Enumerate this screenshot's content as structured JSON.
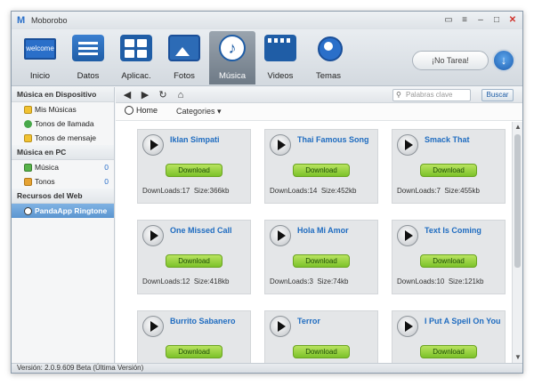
{
  "window": {
    "title": "Moborobo",
    "logo": "M"
  },
  "toolbar": {
    "items": [
      {
        "label": "Inicio",
        "icon": "welcome-icon",
        "badge": "welcome"
      },
      {
        "label": "Datos",
        "icon": "contacts-icon"
      },
      {
        "label": "Aplicac.",
        "icon": "apps-icon"
      },
      {
        "label": "Fotos",
        "icon": "photos-icon"
      },
      {
        "label": "Música",
        "icon": "music-icon"
      },
      {
        "label": "Videos",
        "icon": "videos-icon"
      },
      {
        "label": "Temas",
        "icon": "themes-icon"
      }
    ],
    "active": "Música",
    "task_status": "¡No Tarea!"
  },
  "sidebar": {
    "sections": [
      {
        "header": "Música en Dispositivo",
        "items": [
          {
            "label": "Mis Músicas",
            "icon": "note-icon"
          },
          {
            "label": "Tonos de llamada",
            "icon": "phone-icon"
          },
          {
            "label": "Tonos de mensaje",
            "icon": "message-icon"
          }
        ]
      },
      {
        "header": "Música en PC",
        "items": [
          {
            "label": "Música",
            "icon": "music-folder-icon",
            "count": "0"
          },
          {
            "label": "Tonos",
            "icon": "tones-folder-icon",
            "count": "0"
          }
        ]
      },
      {
        "header": "Recursos del Web",
        "items": [
          {
            "label": "PandaApp Ringtone",
            "icon": "panda-icon",
            "active": true
          }
        ]
      }
    ]
  },
  "navbar": {
    "search_placeholder": "Palabras clave",
    "search_button": "Buscar"
  },
  "breadcrumb": {
    "home": "Home",
    "categories": "Categories"
  },
  "songs": [
    {
      "title": "Iklan Simpati",
      "download": "Download",
      "downloads": "DownLoads:17",
      "size": "Size:366kb"
    },
    {
      "title": "Thai Famous Song",
      "download": "Download",
      "downloads": "DownLoads:14",
      "size": "Size:452kb"
    },
    {
      "title": "Smack That",
      "download": "Download",
      "downloads": "DownLoads:7",
      "size": "Size:455kb"
    },
    {
      "title": "One Missed Call",
      "download": "Download",
      "downloads": "DownLoads:12",
      "size": "Size:418kb"
    },
    {
      "title": "Hola Mi Amor",
      "download": "Download",
      "downloads": "DownLoads:3",
      "size": "Size:74kb"
    },
    {
      "title": "Text Is Coming",
      "download": "Download",
      "downloads": "DownLoads:10",
      "size": "Size:121kb"
    },
    {
      "title": "Burrito Sabanero",
      "download": "Download",
      "downloads": "",
      "size": ""
    },
    {
      "title": "Terror",
      "download": "Download",
      "downloads": "",
      "size": ""
    },
    {
      "title": "I Put A Spell On You",
      "download": "Download",
      "downloads": "",
      "size": ""
    }
  ],
  "status": "Versión: 2.0.9.609 Beta  (Última Versión)"
}
